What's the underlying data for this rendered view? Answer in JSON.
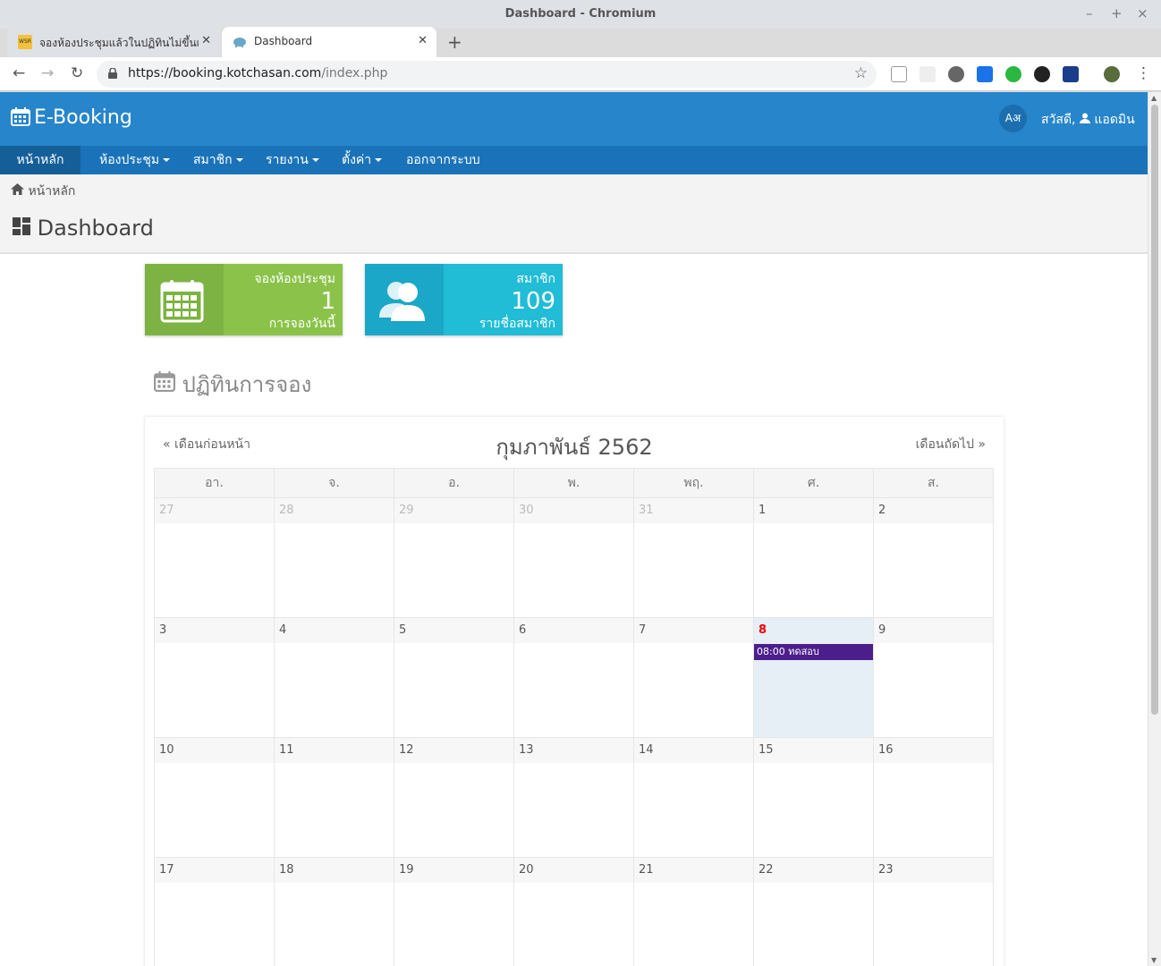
{
  "window": {
    "title": "Dashboard - Chromium",
    "controls": [
      "–",
      "+",
      "×"
    ]
  },
  "tabs": [
    {
      "label": "จองห้องประชุมแล้วในปฏิทินไม่ขึ้นเ",
      "favicon_text": "WSR",
      "active": false
    },
    {
      "label": "Dashboard",
      "active": true
    }
  ],
  "address": {
    "url_host": "https://booking.kotchasan.com",
    "url_path": "/index.php"
  },
  "app": {
    "brand": "E-Booking",
    "lang_label": "Aअ",
    "greeting": "สวัสดี,",
    "user": "แอดมิน",
    "menu": [
      {
        "label": "หน้าหลัก",
        "active": true,
        "dropdown": false
      },
      {
        "label": "ห้องประชุม",
        "dropdown": true
      },
      {
        "label": "สมาชิก",
        "dropdown": true
      },
      {
        "label": "รายงาน",
        "dropdown": true
      },
      {
        "label": "ตั้งค่า",
        "dropdown": true
      },
      {
        "label": "ออกจากระบบ",
        "dropdown": false
      }
    ],
    "breadcrumb": "หน้าหลัก",
    "page_title": "Dashboard"
  },
  "cards": [
    {
      "title": "จองห้องประชุม",
      "value": "1",
      "subtitle": "การจองวันนี้",
      "color_icon": "#7cb342",
      "color_body": "#8bc34a"
    },
    {
      "title": "สมาชิก",
      "value": "109",
      "subtitle": "รายชื่อสมาชิก",
      "color_icon": "#1ba7c7",
      "color_body": "#21bcd6"
    }
  ],
  "calendar": {
    "section_title": "ปฏิทินการจอง",
    "prev": "« เดือนก่อนหน้า",
    "next": "เดือนถัดไป »",
    "month_title": "กุมภาพันธ์ 2562",
    "days": [
      "อา.",
      "จ.",
      "อ.",
      "พ.",
      "พฤ.",
      "ศ.",
      "ส."
    ],
    "weeks": [
      [
        "27",
        "28",
        "29",
        "30",
        "31",
        "1",
        "2"
      ],
      [
        "3",
        "4",
        "5",
        "6",
        "7",
        "8",
        "9"
      ],
      [
        "10",
        "11",
        "12",
        "13",
        "14",
        "15",
        "16"
      ],
      [
        "17",
        "18",
        "19",
        "20",
        "21",
        "22",
        "23"
      ]
    ],
    "today": "8",
    "event": {
      "day": "8",
      "label": "08:00 ทดสอบ",
      "color": "#4c1e8c"
    }
  }
}
